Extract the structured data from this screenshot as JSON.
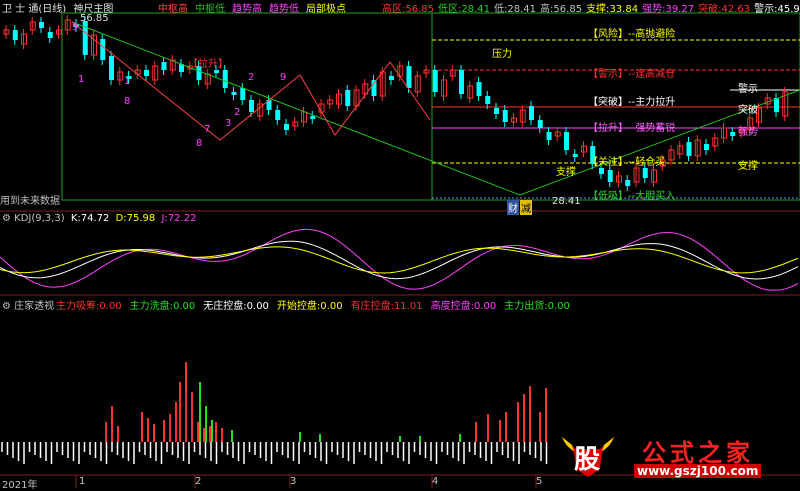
{
  "main_header": {
    "app": "卫 士 通(日线)",
    "indicator": "神尺主图",
    "items": [
      {
        "label": "中枢高",
        "color": "#ff4040"
      },
      {
        "label": "中枢低",
        "color": "#20c020"
      },
      {
        "label": "趋势高",
        "color": "#ff40ff"
      },
      {
        "label": "趋势低",
        "color": "#ff40ff"
      },
      {
        "label": "局部极点",
        "color": "#ffff00"
      }
    ],
    "values": [
      {
        "label": "高区:",
        "value": "56.85",
        "color": "#ff3030"
      },
      {
        "label": "低区:",
        "value": "28.41",
        "color": "#20d020"
      },
      {
        "label": "低:",
        "value": "28.41",
        "color": "#c0c0c0"
      },
      {
        "label": "高:",
        "value": "56.85",
        "color": "#c0c0c0"
      },
      {
        "label": "支撑:",
        "value": "33.84",
        "color": "#ffff00"
      },
      {
        "label": "强势:",
        "value": "39.27",
        "color": "#ff40ff"
      },
      {
        "label": "突破:",
        "value": "42.63",
        "color": "#ff3030"
      },
      {
        "label": "警示:",
        "value": "45.99",
        "color": "#ffffff"
      },
      {
        "label": "压:",
        "value": "",
        "color": "#ffff00"
      }
    ]
  },
  "price_labels": {
    "high_mark": "56.85",
    "low_mark": "28.41",
    "pull_up": "【拉升】",
    "future_data": "用到未来数据",
    "cai": "财",
    "jian": "减"
  },
  "legend_box": {
    "pressure": "压力",
    "support": "支撑",
    "rows": [
      {
        "text": "【风险】--高抛避险",
        "color": "#ffff00"
      },
      {
        "text": "【警示】--逢高减仓",
        "color": "#ff3030"
      },
      {
        "text": "【突破】--主力拉升",
        "color": "#ffffff"
      },
      {
        "text": "【拉升】--强势蓄锐",
        "color": "#ff60ff"
      },
      {
        "text": "【关注】--轻仓买",
        "color": "#ffff00"
      },
      {
        "text": "【低吸】--大胆买入",
        "color": "#20e020"
      }
    ]
  },
  "right_labels": {
    "warn": "警示",
    "break": "突破",
    "strong": "强势",
    "support": "支撑"
  },
  "day_numbers": [
    "9",
    "8",
    "7",
    "1",
    "2",
    "3",
    "9",
    "8",
    "1",
    "2"
  ],
  "kdj": {
    "title": "KDJ(9,3,3)",
    "k_label": "K:",
    "k": "74.72",
    "d_label": "D:",
    "d": "75.98",
    "j_label": "J:",
    "j": "72.22"
  },
  "zhuangjia": {
    "title": "庄家透视",
    "items": [
      {
        "label": "主力吸筹:",
        "value": "0.00",
        "color": "#ff3030"
      },
      {
        "label": "主力洗盘:",
        "value": "0.00",
        "color": "#20e020"
      },
      {
        "label": "无庄控盘:",
        "value": "0.00",
        "color": "#ffffff"
      },
      {
        "label": "开始控盘:",
        "value": "0.00",
        "color": "#ffff00"
      },
      {
        "label": "有庄控盘:",
        "value": "11.01",
        "color": "#ff3030"
      },
      {
        "label": "高度控盘:",
        "value": "0.00",
        "color": "#ff40ff"
      },
      {
        "label": "主力出货:",
        "value": "0.00",
        "color": "#20e020"
      }
    ]
  },
  "timeline": {
    "year": "2021年",
    "months": [
      "1",
      "2",
      "3",
      "4",
      "5"
    ]
  },
  "watermark": {
    "glyph": "股",
    "site_name": "公式之家",
    "url": "www.gszj100.com"
  },
  "colors": {
    "up": "#ff3030",
    "down": "#00ffff",
    "k_line": "#ffffff",
    "d_line": "#ffff00",
    "j_line": "#ff40ff",
    "trend_green": "#20c020"
  }
}
